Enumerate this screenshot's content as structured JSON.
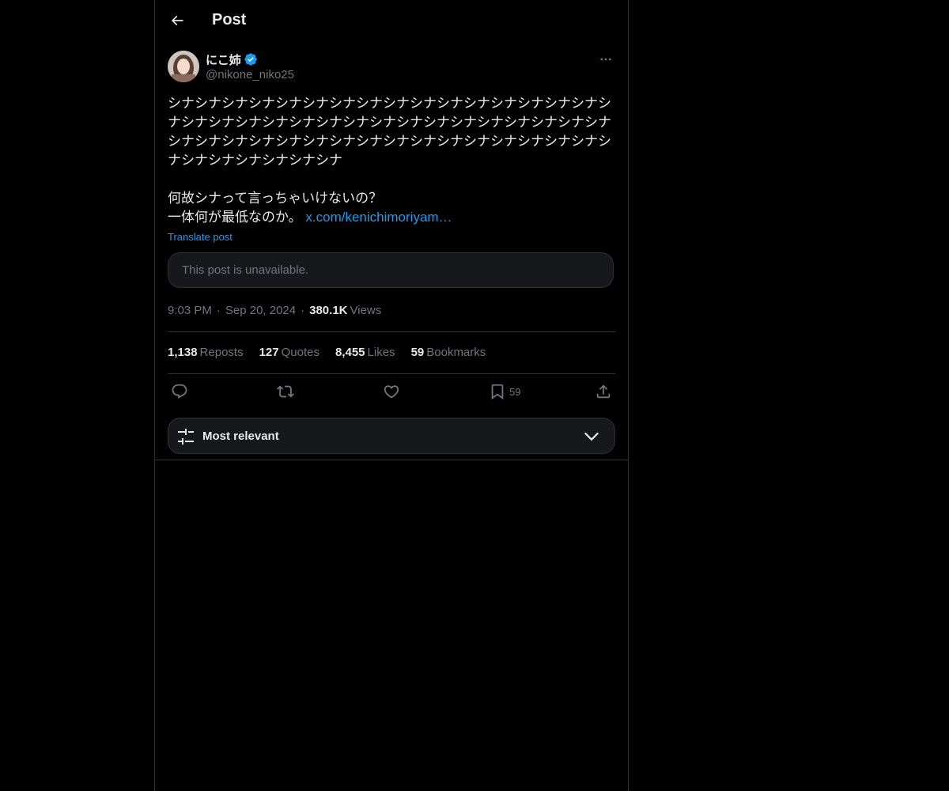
{
  "header": {
    "title": "Post",
    "back_icon": "arrow-left-icon"
  },
  "post": {
    "author": {
      "display_name": "にこ姉",
      "handle": "@nikone_niko25",
      "verified": true,
      "verified_color": "#1d9bf0"
    },
    "text_lines": [
      "シナシナシナシナシナシナシナシナシナシナシナシナシナシナシナシナシ",
      "ナシナシナシナシナシナシナシナシナシナシナシナシナシナシナシナシナ",
      "シナシナシナシナシナシナシナシナシナシナシナシナシナシナシナシナシ",
      "ナシナシナシナシナシナシナ",
      "",
      "何故シナって言っちゃいけないの？",
      "一体何が最低なのか。"
    ],
    "link_text": "x.com/kenichimoriyam…",
    "translate_label": "Translate post",
    "quoted_unavailable": "This post is unavailable.",
    "time": "9:03 PM",
    "date": "Sep 20, 2024",
    "views_count": "380.1K",
    "views_label": "Views",
    "separator": "·"
  },
  "stats": {
    "reposts_count": "1,138",
    "reposts_label": "Reposts",
    "quotes_count": "127",
    "quotes_label": "Quotes",
    "likes_count": "8,455",
    "likes_label": "Likes",
    "bookmarks_count": "59",
    "bookmarks_label": "Bookmarks"
  },
  "actions": {
    "bookmark_count": "59"
  },
  "replies_sort": {
    "label": "Most relevant"
  },
  "colors": {
    "background": "#000000",
    "text_primary": "#e7e9ea",
    "text_secondary": "#71767b",
    "accent": "#1d9bf0",
    "border": "#2f3336"
  }
}
